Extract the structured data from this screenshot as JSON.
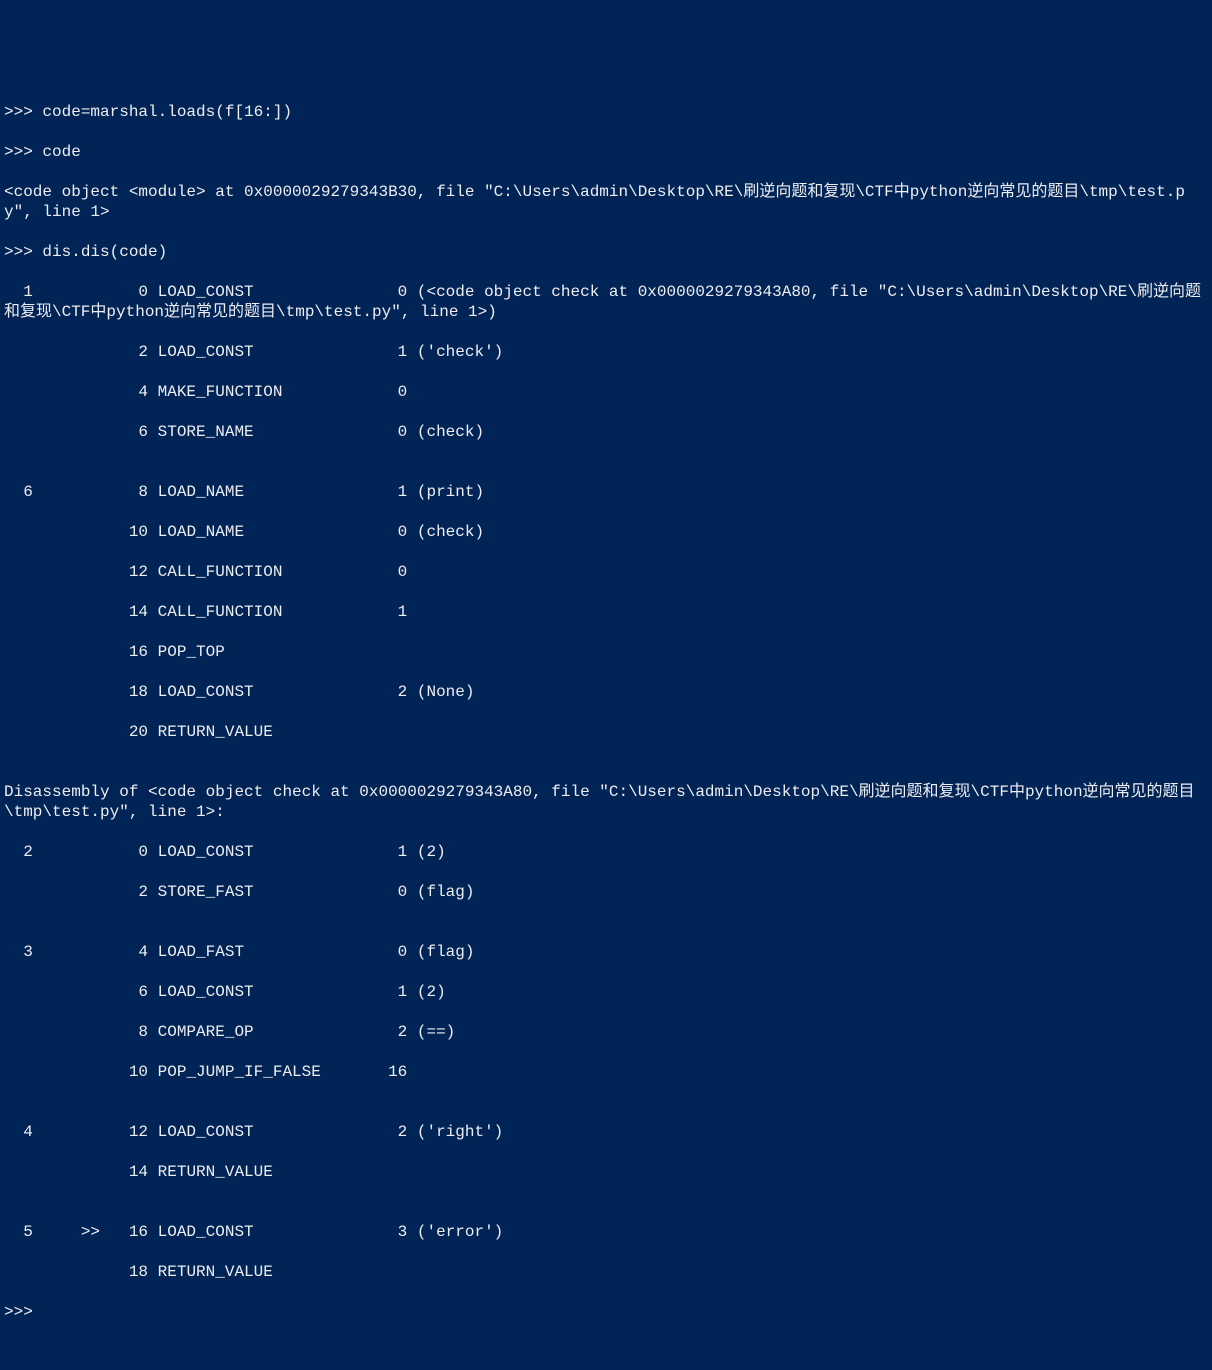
{
  "terminal": {
    "lines": [
      ">>> code=marshal.loads(f[16:])",
      ">>> code",
      "<code object <module> at 0x0000029279343B30, file \"C:\\Users\\admin\\Desktop\\RE\\刷逆向题和复现\\CTF中python逆向常见的题目\\tmp\\test.py\", line 1>",
      ">>> dis.dis(code)",
      "  1           0 LOAD_CONST               0 (<code object check at 0x0000029279343A80, file \"C:\\Users\\admin\\Desktop\\RE\\刷逆向题和复现\\CTF中python逆向常见的题目\\tmp\\test.py\", line 1>)",
      "              2 LOAD_CONST               1 ('check')",
      "              4 MAKE_FUNCTION            0",
      "              6 STORE_NAME               0 (check)",
      "",
      "  6           8 LOAD_NAME                1 (print)",
      "             10 LOAD_NAME                0 (check)",
      "             12 CALL_FUNCTION            0",
      "             14 CALL_FUNCTION            1",
      "             16 POP_TOP",
      "             18 LOAD_CONST               2 (None)",
      "             20 RETURN_VALUE",
      "",
      "Disassembly of <code object check at 0x0000029279343A80, file \"C:\\Users\\admin\\Desktop\\RE\\刷逆向题和复现\\CTF中python逆向常见的题目\\tmp\\test.py\", line 1>:",
      "  2           0 LOAD_CONST               1 (2)",
      "              2 STORE_FAST               0 (flag)",
      "",
      "  3           4 LOAD_FAST                0 (flag)",
      "              6 LOAD_CONST               1 (2)",
      "              8 COMPARE_OP               2 (==)",
      "             10 POP_JUMP_IF_FALSE       16",
      "",
      "  4          12 LOAD_CONST               2 ('right')",
      "             14 RETURN_VALUE",
      "",
      "  5     >>   16 LOAD_CONST               3 ('error')",
      "             18 RETURN_VALUE",
      ">>>"
    ]
  }
}
